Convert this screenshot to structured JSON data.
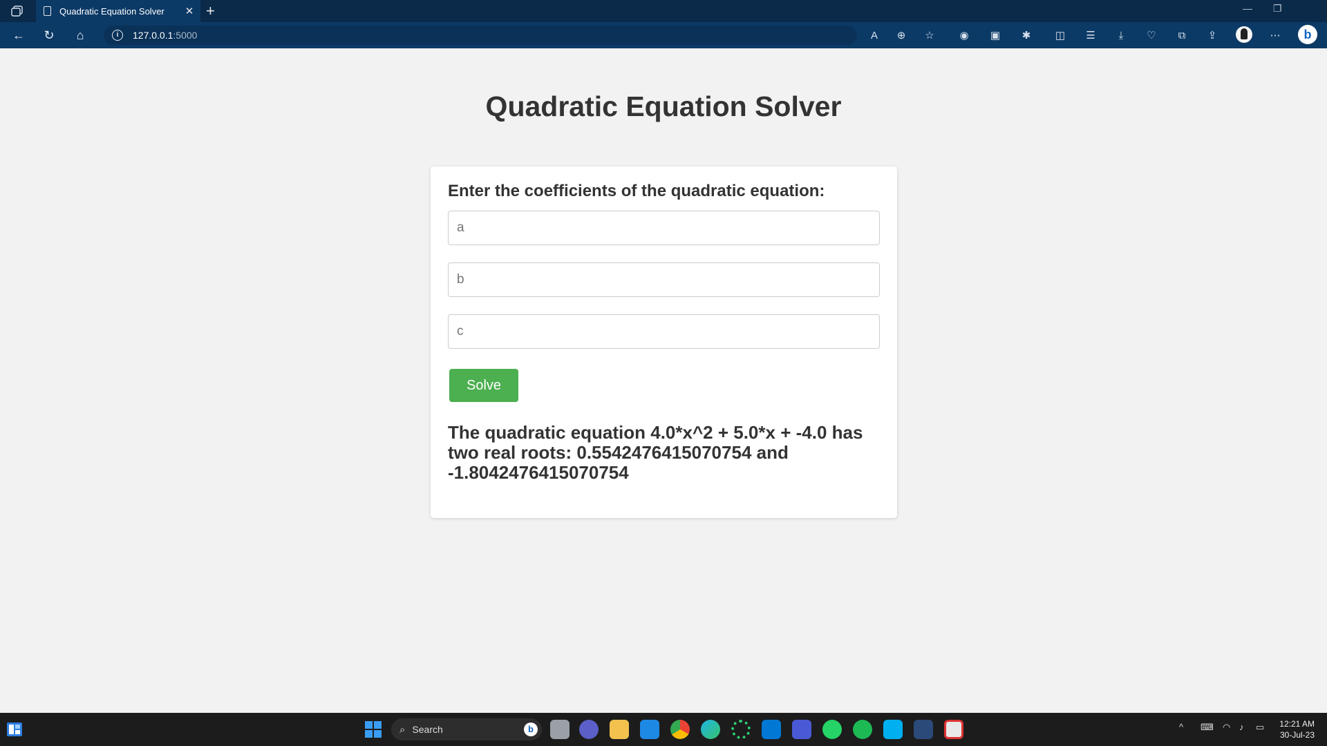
{
  "browser": {
    "tab_title": "Quadratic Equation Solver",
    "url_host": "127.0.0.1",
    "url_port": ":5000"
  },
  "page": {
    "title": "Quadratic Equation Solver",
    "form_heading": "Enter the coefficients of the quadratic equation:",
    "inputs": {
      "a_placeholder": "a",
      "b_placeholder": "b",
      "c_placeholder": "c"
    },
    "solve_label": "Solve",
    "result_text": "The quadratic equation 4.0*x^2 + 5.0*x + -4.0 has two real roots: 0.5542476415070754 and -1.8042476415070754"
  },
  "taskbar": {
    "search_label": "Search",
    "time": "12:21 AM",
    "date": "30-Jul-23"
  },
  "colors": {
    "accent_button": "#4caf50",
    "browser_toolbar": "#0c3a66",
    "page_background": "#f2f2f2"
  }
}
